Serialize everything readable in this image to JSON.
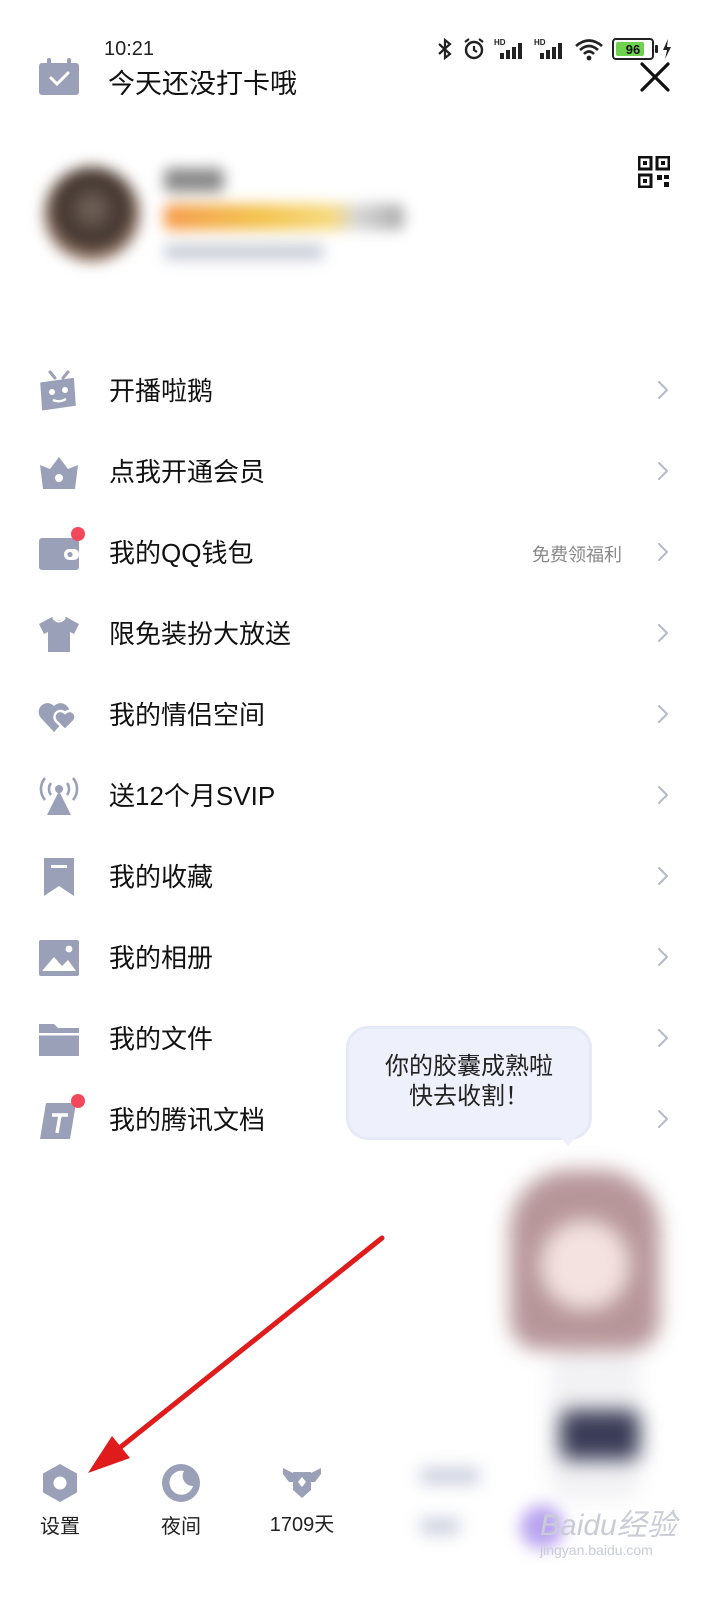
{
  "status_bar": {
    "time": "10:21",
    "battery": "96"
  },
  "header": {
    "checkin_text": "今天还没打卡哦"
  },
  "menu": [
    {
      "label": "开播啦鹅",
      "icon": "robot-tv-icon",
      "extra": "",
      "badge": false
    },
    {
      "label": "点我开通会员",
      "icon": "crown-basket-icon",
      "extra": "",
      "badge": false
    },
    {
      "label": "我的QQ钱包",
      "icon": "wallet-icon",
      "extra": "免费领福利",
      "badge": true
    },
    {
      "label": "限免装扮大放送",
      "icon": "tshirt-icon",
      "extra": "",
      "badge": false
    },
    {
      "label": "我的情侣空间",
      "icon": "double-heart-icon",
      "extra": "",
      "badge": false
    },
    {
      "label": "送12个月SVIP",
      "icon": "broadcast-tower-icon",
      "extra": "",
      "badge": false
    },
    {
      "label": "我的收藏",
      "icon": "bookmark-icon",
      "extra": "",
      "badge": false
    },
    {
      "label": "我的相册",
      "icon": "photo-icon",
      "extra": "",
      "badge": false
    },
    {
      "label": "我的文件",
      "icon": "folder-icon",
      "extra": "",
      "badge": false
    },
    {
      "label": "我的腾讯文档",
      "icon": "tencent-docs-icon",
      "extra": "",
      "badge": true
    }
  ],
  "bubble": {
    "line1": "你的胶囊成熟啦",
    "line2": "快去收割！"
  },
  "bottom_bar": {
    "settings": "设置",
    "night": "夜间",
    "days": "1709天"
  },
  "watermark": {
    "text": "Baidu经验",
    "sub": "jingyan.baidu.com"
  },
  "colors": {
    "icon": "#9aa0b8",
    "badge": "#f5475b",
    "arrow": "#e01b1b"
  }
}
